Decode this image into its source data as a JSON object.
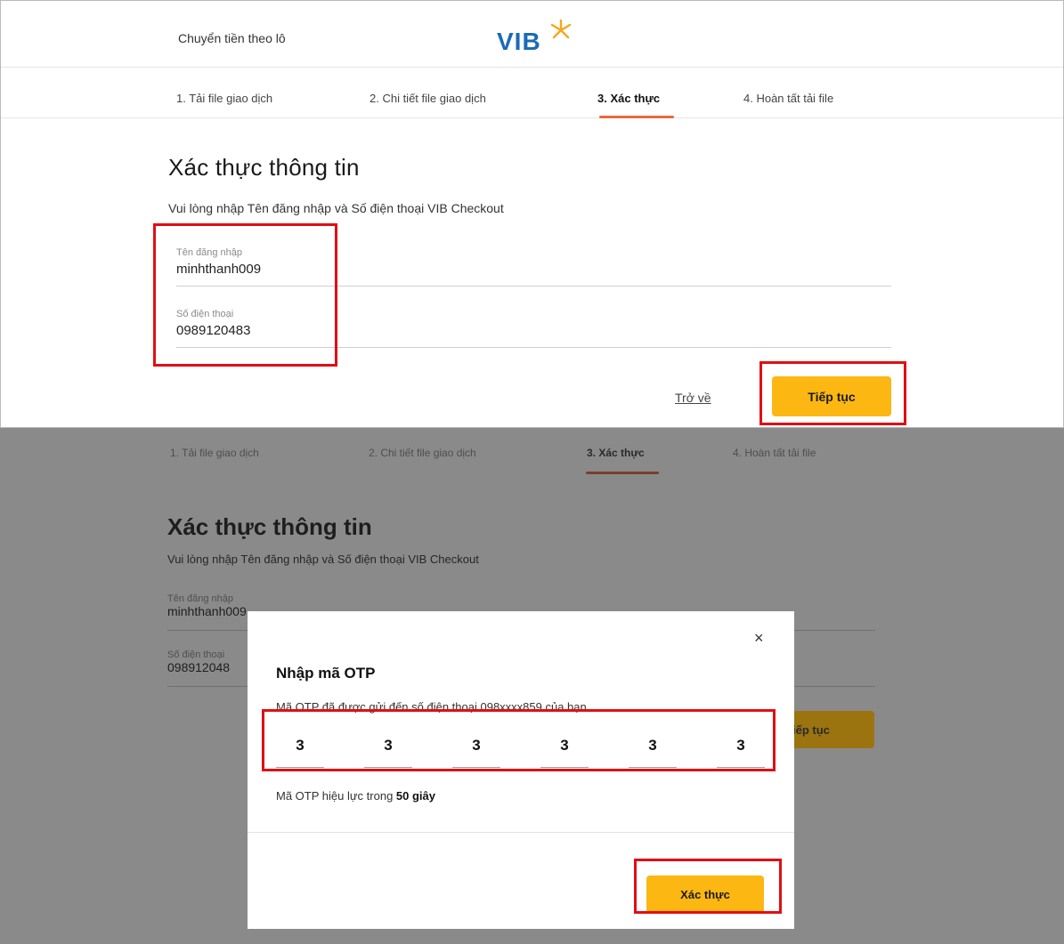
{
  "header": {
    "title": "Chuyển tiền theo lô",
    "logo_text": "VIB"
  },
  "steps": [
    {
      "label": "1. Tải file giao dịch"
    },
    {
      "label": "2. Chi tiết file giao dịch"
    },
    {
      "label": "3. Xác thực",
      "active": true
    },
    {
      "label": "4. Hoàn tất tải file"
    }
  ],
  "form": {
    "heading": "Xác thực thông tin",
    "subtitle": "Vui lòng nhập Tên đăng nhập và Số điện thoại VIB Checkout",
    "username_label": "Tên đăng nhập",
    "username_value": "minhthanh009",
    "phone_label": "Số điện thoại",
    "phone_value": "0989120483",
    "back_label": "Trở về",
    "continue_label": "Tiếp tục"
  },
  "dimmed_form": {
    "username_label": "Tên đăng nhập",
    "username_value": "minhthanh009",
    "phone_label": "Số điện thoại",
    "phone_value": "098912048",
    "continue_label": "iếp tục"
  },
  "otp_modal": {
    "title": "Nhập mã OTP",
    "description": "Mã OTP đã được gửi đến số điện thoại  098xxxx859 của bạn",
    "digits": [
      "3",
      "3",
      "3",
      "3",
      "3",
      "3"
    ],
    "validity_prefix": "Mã OTP hiệu lực trong ",
    "validity_value": "50 giây",
    "confirm_label": "Xác thực",
    "close_icon": "×"
  },
  "colors": {
    "accent_yellow": "#fcb712",
    "brand_blue": "#1b6bb5",
    "step_underline": "#e8683d",
    "highlight_red": "#e10e14"
  }
}
